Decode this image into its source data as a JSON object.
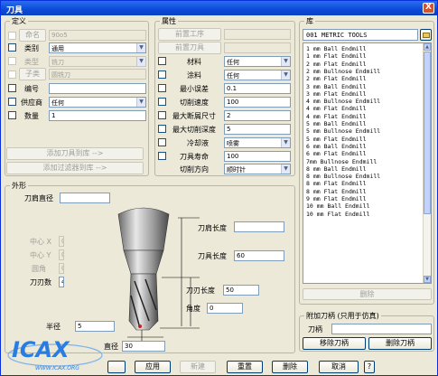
{
  "window": {
    "title": "刀具",
    "close_label": "X",
    "help_label": "?"
  },
  "definition": {
    "group_title": "定义",
    "name_label": "命名",
    "name_value": "90o5",
    "category_label": "类别",
    "category_value": "通用",
    "type_label": "类型",
    "type_value": "铣刀",
    "subtype_label": "子类",
    "subtype_value": "圆铣刀",
    "number_label": "编号",
    "number_value": "",
    "supplier_label": "供应商",
    "supplier_value": "任何",
    "quantity_label": "数量",
    "quantity_value": "1",
    "add_to_library_label": "添加刀具到库 -->",
    "add_filter_label": "添加过滤器到库 -->"
  },
  "properties": {
    "group_title": "属性",
    "front_operation_label": "前置工序",
    "front_tool_label": "前置刀具",
    "material_label": "材料",
    "material_value": "任何",
    "coating_label": "涂料",
    "coating_value": "任何",
    "min_error_label": "最小误差",
    "min_error_value": "0.1",
    "cutting_speed_label": "切削速度",
    "cutting_speed_value": "100",
    "max_section_label": "最大断屑尺寸",
    "max_section_value": "2",
    "max_depth_label": "最大切削深度",
    "max_depth_value": "5",
    "coolant_label": "冷却液",
    "coolant_value": "喷雾",
    "tool_life_label": "刀具寿命",
    "tool_life_value": "100",
    "cut_direction_label": "切削方向",
    "cut_direction_value": "顺时针"
  },
  "library": {
    "group_title": "库",
    "header": "001 METRIC TOOLS",
    "items": [
      "1 mm Ball Endmill",
      "1 mm Flat Endmill",
      "2 mm Flat Endmill",
      "2 mm Bullnose Endmill",
      "2 mm Flat Endmill",
      "3 mm Ball Endmill",
      "3 mm Flat Endmill",
      "4 mm Bullnose Endmill",
      "4 mm Flat Endmill",
      "4 mm Flat Endmill",
      "5 mm Ball Endmill",
      "5 mm Bullnose Endmill",
      "5 mm Flat Endmill",
      "6 mm Ball Endmill",
      "6 mm Flat Endmill",
      "7mm Bullnose Endmill",
      "8 mm Ball Endmill",
      "8 mm Bullnose Endmill",
      "8 mm Flat Endmill",
      "8 mm Flat Endmill",
      "9 mm Flat Endmill",
      "10 mm Ball Endmill",
      "10 mm Flat Endmill"
    ],
    "delete_label": "删除"
  },
  "holder": {
    "group_title": "附加刀柄 (只用于仿真)",
    "holder_label": "刀柄",
    "holder_value": "",
    "remove_label": "移除刀柄",
    "delete_label": "删除刀柄"
  },
  "shape": {
    "group_title": "外形",
    "shank_diameter_label": "刀肩直径",
    "shank_diameter_value": "",
    "center_x_label": "中心 X",
    "center_x_value": "0",
    "center_y_label": "中心 Y",
    "center_y_value": "0",
    "angle_label": "圆角",
    "angle_value": "0",
    "flutes_label": "刀刃数",
    "flutes_value": "4",
    "shoulder_length_label": "刀肩长度",
    "shoulder_length_value": "",
    "tool_length_label": "刀具长度",
    "tool_length_value": "60",
    "flute_length_label": "刀刃长度",
    "flute_length_value": "50",
    "taper_angle_label": "角度",
    "taper_angle_value": "0",
    "radius_label": "半径",
    "radius_value": "5",
    "diameter_label": "直径",
    "diameter_value": "30"
  },
  "footer": {
    "ok_label": "",
    "apply_label": "应用",
    "new_label": "新建",
    "reset_label": "重置",
    "delete_label": "删除",
    "cancel_label": "取消"
  },
  "logo": {
    "text": "ICAX",
    "url_text": "WWW.ICAX.ORG"
  },
  "colors": {
    "title_bar": "#0a4ad8",
    "window_bg": "#ece9d8",
    "logo_blue": "#2a7de0"
  }
}
